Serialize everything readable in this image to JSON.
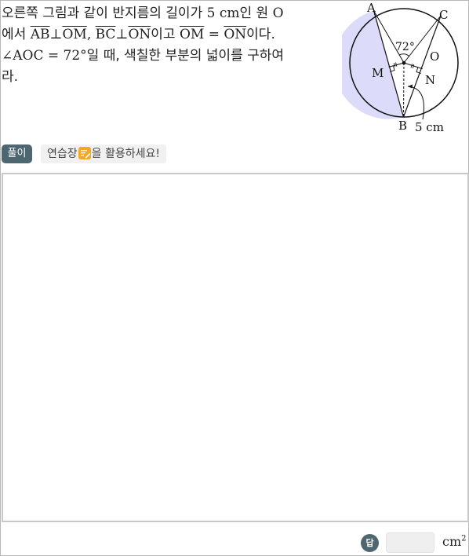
{
  "problem": {
    "line1_a": "오른쪽 그림과 같이 반지름의 길이가 ",
    "line1_value": "5 cm",
    "line1_b": "인 원 ",
    "line1_o": "O",
    "line2_a": "에서 ",
    "seg_ab": "AB",
    "perp1": "⊥",
    "seg_om": "OM",
    "comma": ", ",
    "seg_bc": "BC",
    "perp2": "⊥",
    "seg_on": "ON",
    "line2_b": "이고 ",
    "seg_om2": "OM",
    "eq": " = ",
    "seg_on2": "ON",
    "line2_c": "이다.",
    "line3_angle": "∠AOC = 72°",
    "line3_b": "일 때, 색칠한 부분의 넓이를 구하여",
    "line4": "라."
  },
  "figure": {
    "label_a": "A",
    "label_c": "C",
    "label_o": "O",
    "label_m": "M",
    "label_n": "N",
    "label_b": "B",
    "angle_label": "72°",
    "radius_label": "5 cm",
    "shade_color": "#dcdcfa"
  },
  "tools": {
    "solution_label": "풀이",
    "practice_before": "연습장",
    "practice_after": "을 활용하세요!",
    "memo_icon": "memo-pencil-icon"
  },
  "answer": {
    "badge": "답",
    "value": "",
    "unit": "cm",
    "unit_sup": "2"
  }
}
